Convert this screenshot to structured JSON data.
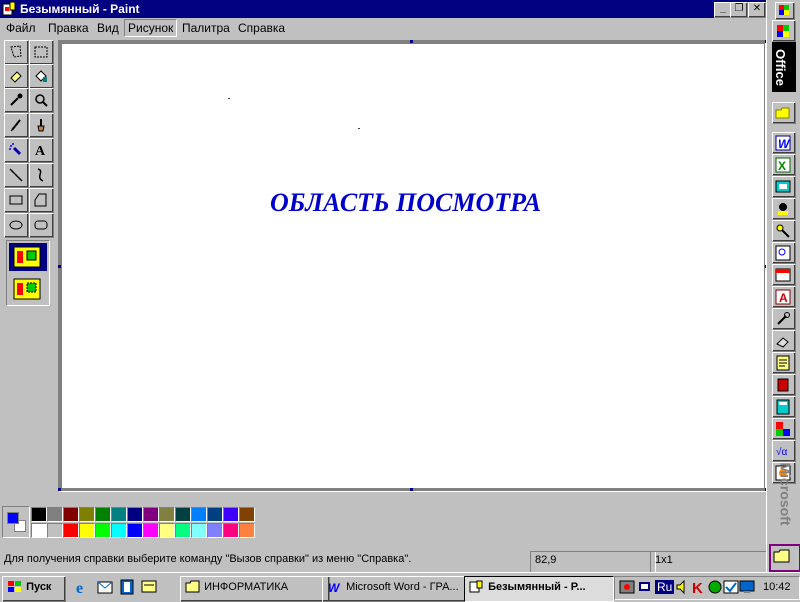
{
  "window": {
    "title": "Безымянный - Paint",
    "controls": {
      "minimize": "_",
      "restore": "❐",
      "close": "✕"
    }
  },
  "menu": [
    {
      "label": "Файл"
    },
    {
      "label": "Правка"
    },
    {
      "label": "Вид"
    },
    {
      "label": "Рисунок"
    },
    {
      "label": "Палитра"
    },
    {
      "label": "Справка"
    }
  ],
  "tools": [
    "free-select-icon",
    "rect-select-icon",
    "eraser-icon",
    "fill-icon",
    "color-picker-icon",
    "magnifier-icon",
    "pencil-icon",
    "brush-icon",
    "airbrush-icon",
    "text-icon",
    "line-icon",
    "curve-icon",
    "rectangle-icon",
    "polygon-icon",
    "ellipse-icon",
    "rounded-rect-icon"
  ],
  "canvas": {
    "title": "ОБЛАСТЬ ПОСМОТРА"
  },
  "palette": {
    "foreground": "#0000ff",
    "background": "#ffffff",
    "row1": [
      "#000000",
      "#808080",
      "#800000",
      "#808000",
      "#008000",
      "#008080",
      "#000080",
      "#800080",
      "#808040",
      "#004040",
      "#0080ff",
      "#004080",
      "#4000ff",
      "#804000"
    ],
    "row2": [
      "#ffffff",
      "#c0c0c0",
      "#ff0000",
      "#ffff00",
      "#00ff00",
      "#00ffff",
      "#0000ff",
      "#ff00ff",
      "#ffff80",
      "#00ff80",
      "#80ffff",
      "#8080ff",
      "#ff0080",
      "#ff8040"
    ]
  },
  "status": {
    "help": "Для получения справки выберите команду \"Вызов справки\" из меню \"Справка\".",
    "coords": "82,9",
    "size": "1x1"
  },
  "officebar": {
    "label": "Office",
    "brand": "Microsoft"
  },
  "taskbar": {
    "start": "Пуск",
    "tasks": [
      {
        "label": "ИНФОРМАТИКА"
      },
      {
        "label": "Microsoft Word - ГРА..."
      },
      {
        "label": "Безымянный - Р..."
      }
    ],
    "language": "Ru",
    "clock": "10:42"
  }
}
